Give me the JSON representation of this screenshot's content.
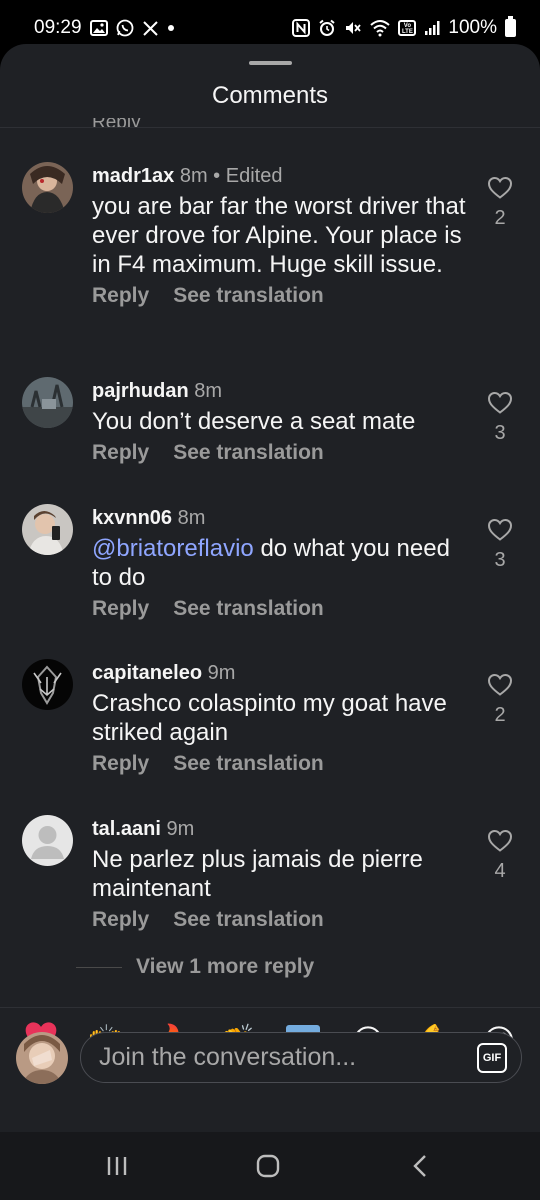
{
  "status_bar": {
    "time": "09:29",
    "left_icons": [
      "gallery-icon",
      "whatsapp-icon",
      "x-icon",
      "dot"
    ],
    "right_icons": [
      "nfc-icon",
      "alarm-icon",
      "mute-icon",
      "wifi-icon",
      "volte-icon",
      "signal-icon"
    ],
    "battery": "100%",
    "volte_label": "Vo LTE"
  },
  "sheet": {
    "title": "Comments",
    "cut_reply_label": "Reply"
  },
  "comments": [
    {
      "username": "madr1ax",
      "meta": "8m • Edited",
      "text": "you are bar far the worst driver that ever drove for Alpine. Your place is in F4 maximum. Huge skill issue.",
      "mention": "",
      "reply_label": "Reply",
      "translate_label": "See translation",
      "likes": "2"
    },
    {
      "username": "pajrhudan",
      "meta": "8m",
      "text": "You don’t deserve a seat mate",
      "mention": "",
      "reply_label": "Reply",
      "translate_label": "See translation",
      "likes": "3"
    },
    {
      "username": "kxvnn06",
      "meta": "8m",
      "text": "do what you need to do",
      "mention": "@briatoreflavio",
      "reply_label": "Reply",
      "translate_label": "See translation",
      "likes": "3"
    },
    {
      "username": "capitaneleo",
      "meta": "9m",
      "text": "Crashco colaspinto my goat have striked again",
      "mention": "",
      "reply_label": "Reply",
      "translate_label": "See translation",
      "likes": "2"
    },
    {
      "username": "tal.aani",
      "meta": "9m",
      "text": "Ne parlez plus jamais de pierre maintenant",
      "mention": "",
      "reply_label": "Reply",
      "translate_label": "See translation",
      "likes": "4"
    }
  ],
  "view_more": "View 1 more reply",
  "emoji_bar": [
    "❤️",
    "🙌",
    "🔥",
    "👏",
    "🇦🇷",
    "😍",
    "💪",
    "😂"
  ],
  "composer": {
    "placeholder": "Join the conversation...",
    "gif_label": "GIF"
  },
  "nav": [
    "recents-icon",
    "home-icon",
    "back-icon"
  ],
  "colors": {
    "background": "#1f2125",
    "mention": "#8fa6ff",
    "secondary_text": "#a8a8a8",
    "heart_emoji": "#e8335a"
  }
}
